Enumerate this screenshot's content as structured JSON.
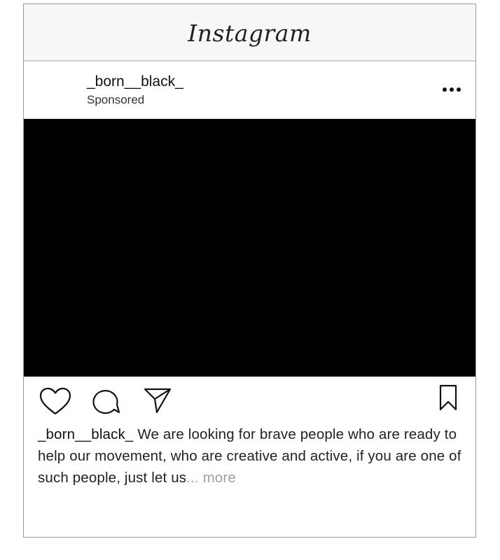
{
  "app": {
    "title": "Instagram"
  },
  "post": {
    "username": "_born__black_",
    "sponsored_label": "Sponsored",
    "caption_user": "_born__black_",
    "caption_text": "We are looking for brave people who are ready to help our movement, who are creative and active, if you are one of such people, just let us",
    "ellipsis": "...",
    "more_label": "more"
  },
  "icons": {
    "options": "more-options-icon",
    "like": "heart-icon",
    "comment": "comment-icon",
    "share": "send-icon",
    "save": "bookmark-icon"
  },
  "colors": {
    "header_bg": "#f7f7f7",
    "border": "#9a9a9a",
    "media_bg": "#000000",
    "muted_text": "#a0a0a0"
  }
}
